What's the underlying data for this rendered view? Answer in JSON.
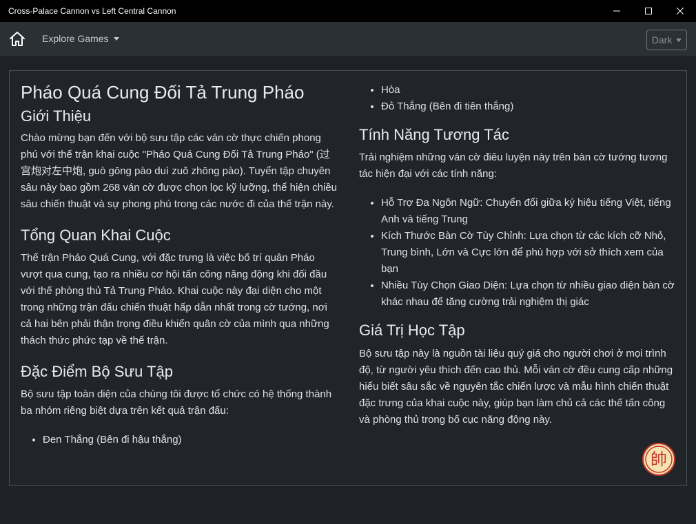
{
  "window": {
    "title": "Cross-Palace Cannon vs Left Central Cannon"
  },
  "navbar": {
    "explore_label": "Explore Games",
    "theme_label": "Dark"
  },
  "article": {
    "title": "Pháo Quá Cung Đối Tả Trung Pháo",
    "intro_heading": "Giới Thiệu",
    "intro_text": "Chào mừng bạn đến với bộ sưu tập các ván cờ thực chiến phong phú với thế trận khai cuộc \"Pháo Quá Cung Đối Tả Trung Pháo\" (过宫炮对左中炮, guò gōng pào duì zuǒ zhōng pào). Tuyển tập chuyên sâu này bao gồm 268 ván cờ được chọn lọc kỹ lưỡng, thể hiện chiều sâu chiến thuật và sự phong phú trong các nước đi của thế trận này.",
    "overview_heading": "Tổng Quan Khai Cuộc",
    "overview_text": "Thế trận Pháo Quá Cung, với đặc trưng là việc bố trí quân Pháo vượt qua cung, tạo ra nhiều cơ hội tấn công năng động khi đối đầu với thế phòng thủ Tả Trung Pháo. Khai cuộc này đại diện cho một trong những trận đấu chiến thuật hấp dẫn nhất trong cờ tướng, nơi cả hai bên phải thận trọng điều khiển quân cờ của mình qua những thách thức phức tạp về thế trận.",
    "collection_heading": "Đặc Điểm Bộ Sưu Tập",
    "collection_text": "Bộ sưu tập toàn diện của chúng tôi được tổ chức có hệ thống thành ba nhóm riêng biệt dựa trên kết quả trận đấu:",
    "results": [
      "Đen Thắng (Bên đi hậu thắng)",
      "Hòa",
      "Đỏ Thắng (Bên đi tiên thắng)"
    ],
    "features_heading": "Tính Năng Tương Tác",
    "features_text": "Trải nghiệm những ván cờ điêu luyện này trên bàn cờ tướng tương tác hiện đại với các tính năng:",
    "features": [
      "Hỗ Trợ Đa Ngôn Ngữ: Chuyển đổi giữa ký hiệu tiếng Việt, tiếng Anh và tiếng Trung",
      "Kích Thước Bàn Cờ Tùy Chỉnh: Lựa chọn từ các kích cỡ Nhỏ, Trung bình, Lớn và Cực lớn để phù hợp với sở thích xem của bạn",
      "Nhiều Tùy Chọn Giao Diện: Lựa chọn từ nhiều giao diện bàn cờ khác nhau để tăng cường trải nghiệm thị giác"
    ],
    "value_heading": "Giá Trị Học Tập",
    "value_text": "Bộ sưu tập này là nguồn tài liệu quý giá cho người chơi ở mọi trình độ, từ người yêu thích đến cao thủ. Mỗi ván cờ đều cung cấp những hiểu biết sâu sắc về nguyên tắc chiến lược và mẫu hình chiến thuật đặc trưng của khai cuộc này, giúp bạn làm chủ cả các thế tấn công và phòng thủ trong bố cục năng động này."
  },
  "seal": {
    "glyph": "帥"
  },
  "colors": {
    "titlebar": "#000000",
    "navbar": "#2b3035",
    "background": "#1e2126",
    "seal_red": "#c0392b",
    "seal_fill": "#f6e3b4"
  },
  "icons": {
    "home": "home-icon",
    "minimize": "minimize-icon",
    "maximize": "maximize-icon",
    "close": "close-icon"
  }
}
